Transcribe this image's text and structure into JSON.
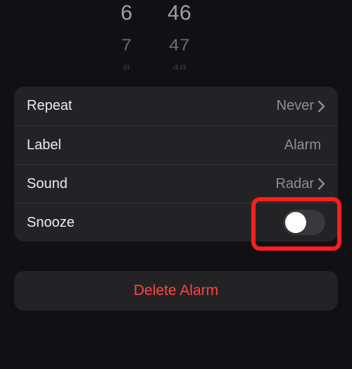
{
  "picker": {
    "hour": {
      "r0": "6",
      "r1": "7",
      "r2": "8"
    },
    "minute": {
      "r0": "46",
      "r1": "47",
      "r2": "48"
    }
  },
  "rows": {
    "repeat": {
      "label": "Repeat",
      "value": "Never"
    },
    "label": {
      "label": "Label",
      "value": "Alarm"
    },
    "sound": {
      "label": "Sound",
      "value": "Radar"
    },
    "snooze": {
      "label": "Snooze"
    }
  },
  "delete_label": "Delete Alarm",
  "colors": {
    "accent_destructive": "#ff453a",
    "highlight": "#ff1e1e"
  }
}
